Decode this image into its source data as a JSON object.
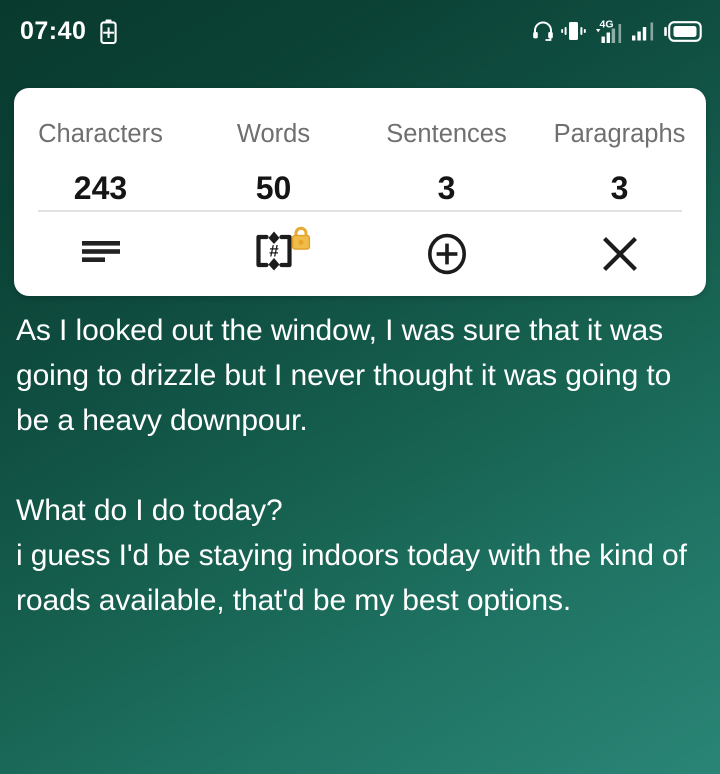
{
  "status_bar": {
    "time": "07:40",
    "icons": [
      {
        "name": "battery-saver-icon",
        "label": "battery-plus"
      },
      {
        "name": "headset-icon",
        "label": "headset"
      },
      {
        "name": "vibrate-icon",
        "label": "vibrate"
      },
      {
        "name": "signal-4g-icon",
        "label": "4G"
      },
      {
        "name": "signal-bars-icon",
        "label": "signal"
      },
      {
        "name": "signal-bars-2-icon",
        "label": "signal-2"
      },
      {
        "name": "battery-icon",
        "label": "battery"
      }
    ],
    "network_label": "4G"
  },
  "stats_card": {
    "stats": [
      {
        "label": "Characters",
        "value": "243"
      },
      {
        "label": "Words",
        "value": "50"
      },
      {
        "label": "Sentences",
        "value": "3"
      },
      {
        "label": "Paragraphs",
        "value": "3"
      }
    ],
    "actions": [
      {
        "name": "format-align-left-button",
        "icon": "align-left-icon",
        "locked": false
      },
      {
        "name": "markdown-toggle-button",
        "icon": "bracket-hash-icon",
        "locked": true
      },
      {
        "name": "add-button",
        "icon": "plus-circle-icon",
        "locked": false
      },
      {
        "name": "close-button",
        "icon": "close-x-icon",
        "locked": false
      }
    ]
  },
  "note": {
    "text": "As I looked out the window, I was sure that it was going to drizzle but I never thought it was going to be a heavy downpour.\n\nWhat do I do today?\ni guess I'd be staying indoors today with the kind of roads available, that'd be my best options."
  },
  "colors": {
    "bg_top": "#093a2e",
    "bg_bottom": "#2a8576",
    "card_bg": "#ffffff",
    "label_gray": "#6f6f6f",
    "value_black": "#151515",
    "lock_amber": "#e8ab2e",
    "text_white": "#ffffff"
  }
}
